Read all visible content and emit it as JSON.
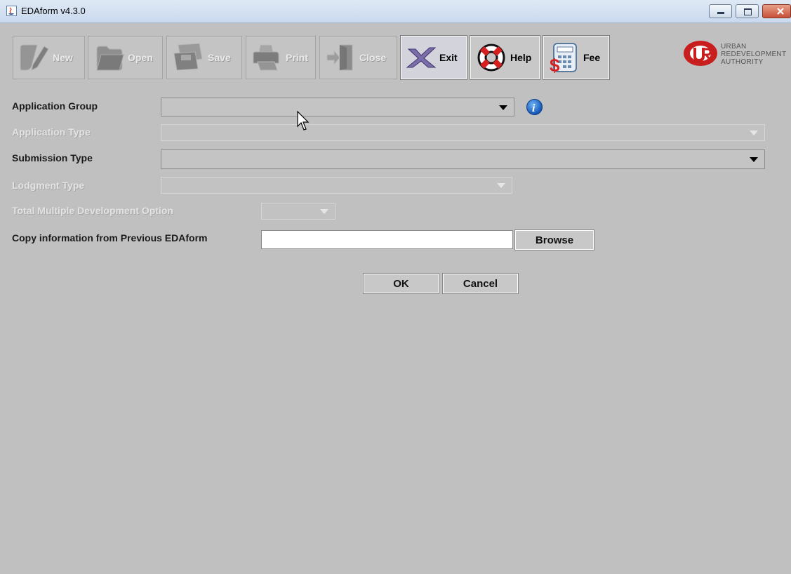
{
  "window": {
    "title": "EDAform v4.3.0"
  },
  "toolbar": {
    "buttons": [
      {
        "label": "New",
        "icon": "pencil-icon",
        "enabled": false
      },
      {
        "label": "Open",
        "icon": "folder-icon",
        "enabled": false
      },
      {
        "label": "Save",
        "icon": "floppy-icon",
        "enabled": false
      },
      {
        "label": "Print",
        "icon": "printer-icon",
        "enabled": false
      },
      {
        "label": "Close",
        "icon": "door-exit-icon",
        "enabled": false
      },
      {
        "label": "Exit",
        "icon": "x-icon",
        "enabled": true
      },
      {
        "label": "Help",
        "icon": "lifebuoy-icon",
        "enabled": true
      },
      {
        "label": "Fee",
        "icon": "calculator-dollar-icon",
        "enabled": true
      }
    ]
  },
  "logo": {
    "line1": "URBAN",
    "line2": "REDEVELOPMENT",
    "line3": "AUTHORITY"
  },
  "form": {
    "application_group": {
      "label": "Application Group",
      "value": ""
    },
    "application_type": {
      "label": "Application Type",
      "value": ""
    },
    "submission_type": {
      "label": "Submission Type",
      "value": ""
    },
    "lodgment_type": {
      "label": "Lodgment Type",
      "value": ""
    },
    "total_multiple": {
      "label": "Total Multiple Development Option",
      "value": ""
    },
    "copy_info": {
      "label": "Copy information from Previous EDAform",
      "value": "",
      "browse_label": "Browse"
    }
  },
  "actions": {
    "ok_label": "OK",
    "cancel_label": "Cancel"
  }
}
